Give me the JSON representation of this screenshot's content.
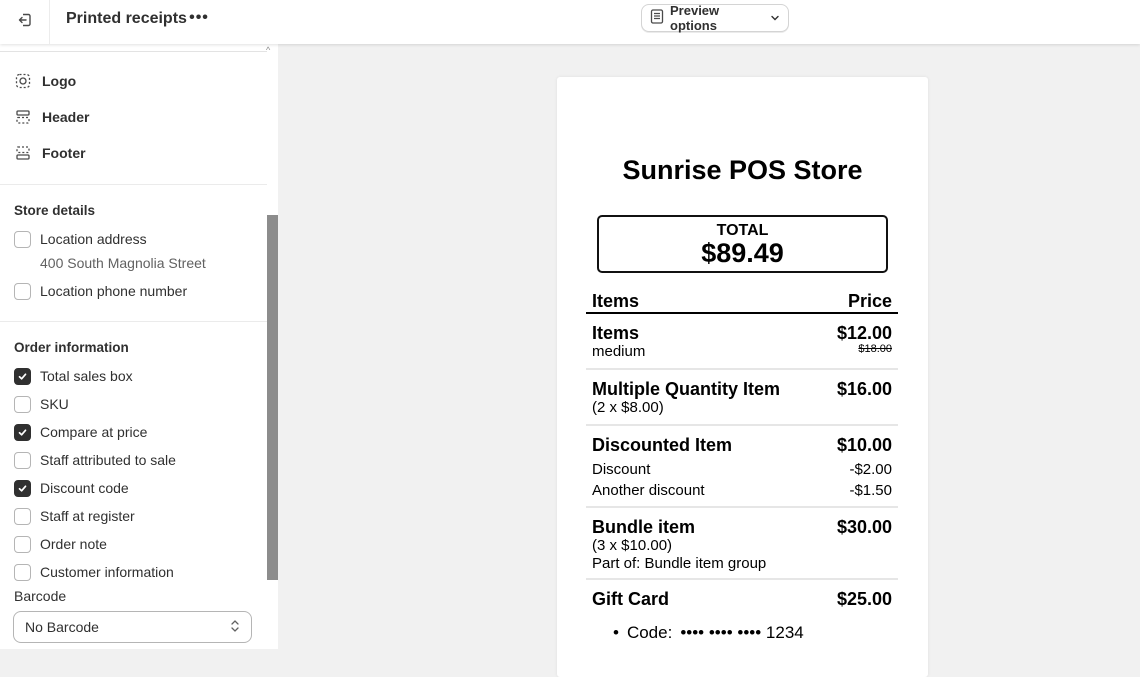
{
  "topbar": {
    "exit_icon": "exit-icon",
    "title": "Printed receipts",
    "more_label": "•••",
    "preview_button": {
      "icon": "receipt-icon",
      "label": "Preview options",
      "chevron": "chevron-down-icon"
    }
  },
  "sidebar": {
    "nav": [
      {
        "icon": "logo-placeholder-icon",
        "label": "Logo"
      },
      {
        "icon": "header-layout-icon",
        "label": "Header"
      },
      {
        "icon": "footer-layout-icon",
        "label": "Footer"
      }
    ],
    "store_details": {
      "title": "Store details",
      "options": [
        {
          "label": "Location address",
          "checked": false,
          "sub": "400 South Magnolia Street"
        },
        {
          "label": "Location phone number",
          "checked": false
        }
      ]
    },
    "order_information": {
      "title": "Order information",
      "options": [
        {
          "label": "Total sales box",
          "checked": true
        },
        {
          "label": "SKU",
          "checked": false
        },
        {
          "label": "Compare at price",
          "checked": true
        },
        {
          "label": "Staff attributed to sale",
          "checked": false
        },
        {
          "label": "Discount code",
          "checked": true
        },
        {
          "label": "Staff at register",
          "checked": false
        },
        {
          "label": "Order note",
          "checked": false
        },
        {
          "label": "Customer information",
          "checked": false
        }
      ]
    },
    "barcode": {
      "label": "Barcode",
      "value": "No Barcode"
    }
  },
  "receipt": {
    "store_name": "Sunrise POS Store",
    "total_label": "TOTAL",
    "total_value": "$89.49",
    "header": {
      "items": "Items",
      "price": "Price"
    },
    "lines": [
      {
        "name": "Items",
        "price": "$12.00",
        "sub": [
          "medium"
        ],
        "compare_at": "$18.00"
      },
      {
        "name": "Multiple Quantity Item",
        "price": "$16.00",
        "sub": [
          "(2 x $8.00)"
        ]
      },
      {
        "name": "Discounted Item",
        "price": "$10.00",
        "discounts": [
          {
            "label": "Discount",
            "amount": "-$2.00"
          },
          {
            "label": "Another discount",
            "amount": "-$1.50"
          }
        ]
      },
      {
        "name": "Bundle item",
        "price": "$30.00",
        "sub": [
          "(3 x $10.00)",
          "Part of: Bundle item group"
        ]
      },
      {
        "name": "Gift Card",
        "price": "$25.00",
        "code_label": "Code:",
        "code_value": "•••• •••• •••• 1234"
      }
    ]
  },
  "colors": {
    "checked_fill": "#303030",
    "scroll_thumb": "#8c8c8c",
    "canvas_bg": "#f1f1f1"
  }
}
